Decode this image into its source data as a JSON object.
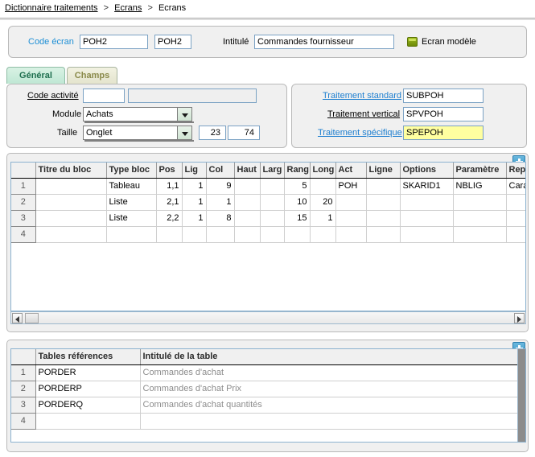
{
  "breadcrumb": {
    "items": [
      "Dictionnaire traitements",
      "Ecrans",
      "Ecrans"
    ],
    "separator": ">"
  },
  "header": {
    "code_ecran_label": "Code écran",
    "code_ecran_value": "POH2",
    "code_ecran_value2": "POH2",
    "intitule_label": "Intitulé",
    "intitule_value": "Commandes fournisseur",
    "model_label": "Ecran modèle",
    "model_icon": "green-checkbox-icon"
  },
  "tabs": [
    {
      "label": "Général",
      "active": true
    },
    {
      "label": "Champs",
      "active": false
    }
  ],
  "left_panel": {
    "code_activite_label": "Code activité",
    "code_activite_value": "",
    "code_activite_desc": "",
    "module_label": "Module",
    "module_value": "Achats",
    "taille_label": "Taille",
    "taille_value": "Onglet",
    "taille_num1": "23",
    "taille_num2": "74"
  },
  "right_panel": {
    "traitement_standard_label": "Traitement standard",
    "traitement_standard_value": "SUBPOH",
    "traitement_vertical_label": "Traitement vertical",
    "traitement_vertical_value": "SPVPOH",
    "traitement_specifique_label": "Traitement spécifique",
    "traitement_specifique_value": "SPEPOH",
    "highlight_color": "#ffffa0"
  },
  "blocks_grid": {
    "headers": [
      "",
      "Titre du bloc",
      "Type bloc",
      "Pos",
      "Lig",
      "Col",
      "Haut",
      "Larg",
      "Rang",
      "Long",
      "Act",
      "Ligne",
      "Options",
      "Paramètre",
      "Repré"
    ],
    "rows": [
      {
        "n": "1",
        "titre": "",
        "type": "Tableau",
        "pos": "1,1",
        "lig": "1",
        "col": "9",
        "haut": "",
        "larg": "",
        "rang": "5",
        "long": "",
        "act": "POH",
        "ligne": "",
        "options": "SKARID1",
        "parametre": "NBLIG",
        "repre": "Caracté"
      },
      {
        "n": "2",
        "titre": "",
        "type": "Liste",
        "pos": "2,1",
        "lig": "1",
        "col": "1",
        "haut": "",
        "larg": "",
        "rang": "10",
        "long": "20",
        "act": "",
        "ligne": "",
        "options": "",
        "parametre": "",
        "repre": ""
      },
      {
        "n": "3",
        "titre": "",
        "type": "Liste",
        "pos": "2,2",
        "lig": "1",
        "col": "8",
        "haut": "",
        "larg": "",
        "rang": "15",
        "long": "1",
        "act": "",
        "ligne": "",
        "options": "",
        "parametre": "",
        "repre": ""
      },
      {
        "n": "4",
        "titre": "",
        "type": "",
        "pos": "",
        "lig": "",
        "col": "",
        "haut": "",
        "larg": "",
        "rang": "",
        "long": "",
        "act": "",
        "ligne": "",
        "options": "",
        "parametre": "",
        "repre": ""
      }
    ],
    "add_icon": "plus-icon",
    "scrollbar": {
      "left_arrow": "arrow-left-icon",
      "right_arrow": "arrow-right-icon"
    }
  },
  "tables_grid": {
    "headers": [
      "",
      "Tables références",
      "Intitulé de la table"
    ],
    "rows": [
      {
        "n": "1",
        "table": "PORDER",
        "intitule": "Commandes d'achat"
      },
      {
        "n": "2",
        "table": "PORDERP",
        "intitule": "Commandes d'achat Prix"
      },
      {
        "n": "3",
        "table": "PORDERQ",
        "intitule": "Commandes d'achat quantités"
      },
      {
        "n": "4",
        "table": "",
        "intitule": ""
      }
    ],
    "add_icon": "plus-icon"
  }
}
